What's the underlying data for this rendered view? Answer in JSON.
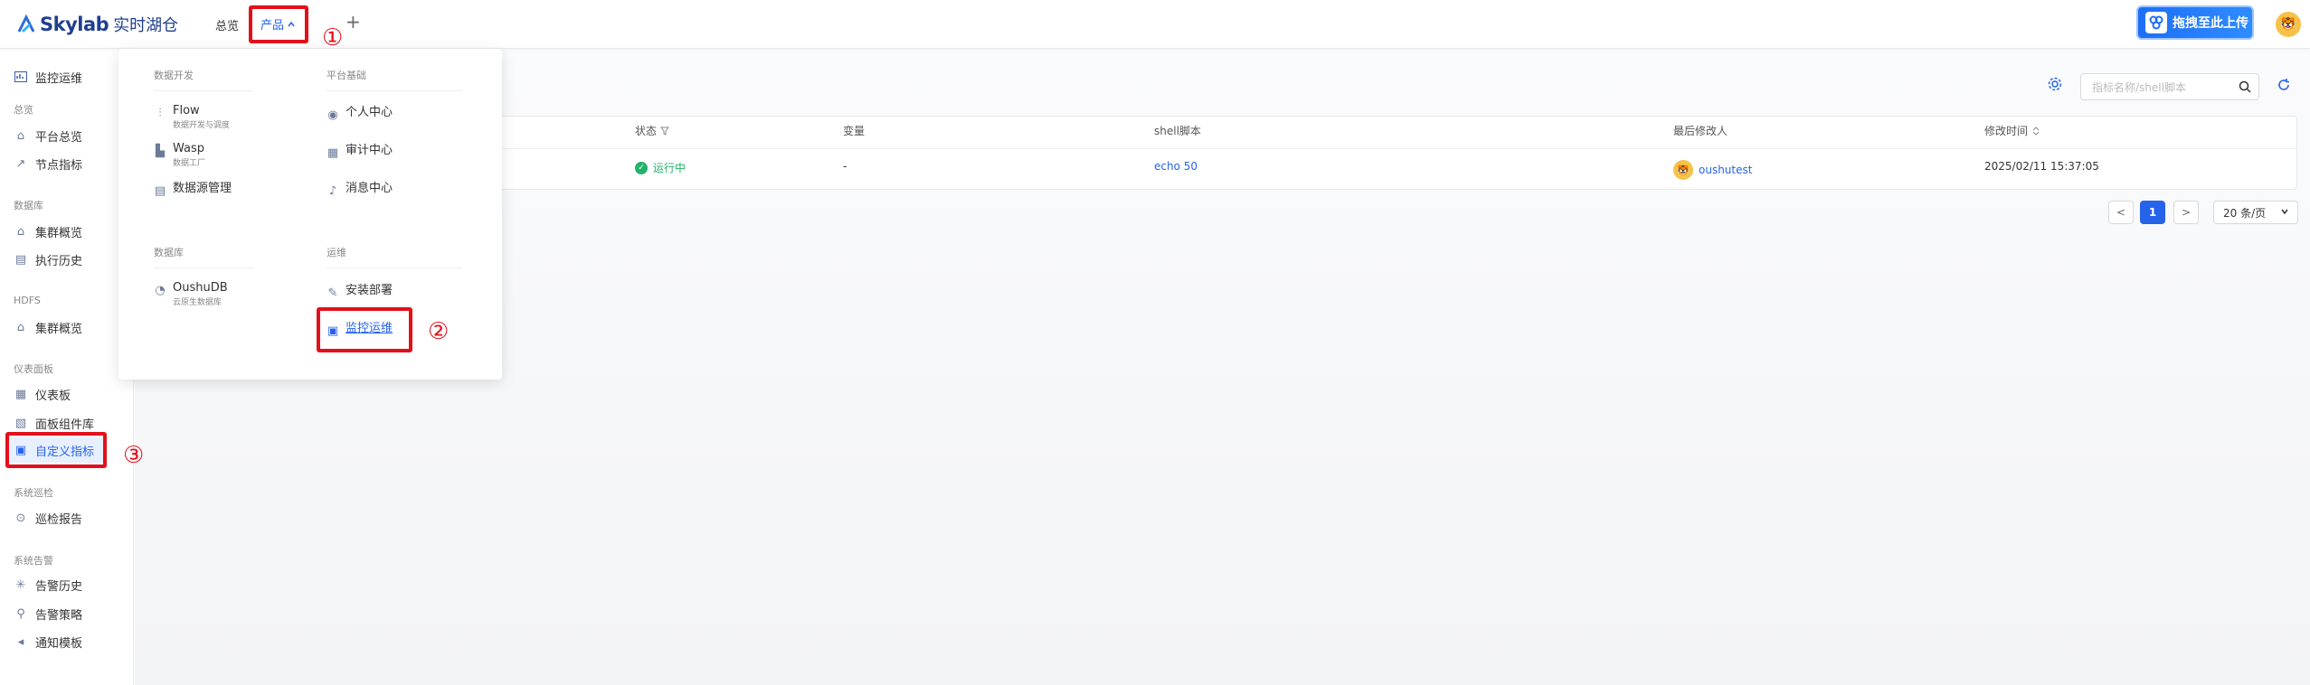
{
  "app": {
    "brand": "Skylab",
    "brand_cn": "实时湖仓"
  },
  "topnav": {
    "overview": "总览",
    "product": "产品",
    "plus": "+"
  },
  "upload": {
    "label": "拖拽至此上传"
  },
  "sidebar": {
    "top_item": "监控运维",
    "groups": [
      {
        "title": "总览",
        "items": [
          "平台总览",
          "节点指标"
        ]
      },
      {
        "title": "数据库",
        "items": [
          "集群概览",
          "执行历史"
        ]
      },
      {
        "title": "HDFS",
        "items": [
          "集群概览"
        ]
      },
      {
        "title": "仪表面板",
        "items": [
          "仪表板",
          "面板组件库",
          "自定义指标"
        ]
      },
      {
        "title": "系统巡检",
        "items": [
          "巡检报告"
        ]
      },
      {
        "title": "系统告警",
        "items": [
          "告警历史",
          "告警策略",
          "通知模板"
        ]
      }
    ]
  },
  "dropdown": {
    "col1_title": "数据开发",
    "col2_title": "平台基础",
    "col3_title": "数据库",
    "col4_title": "运维",
    "flow": {
      "title": "Flow",
      "sub": "数据开发与调度"
    },
    "wasp": {
      "title": "Wasp",
      "sub": "数据工厂"
    },
    "datasource": "数据源管理",
    "personal": "个人中心",
    "audit": "审计中心",
    "message": "消息中心",
    "oushudb": {
      "title": "OushuDB",
      "sub": "云原生数据库"
    },
    "install": "安装部署",
    "monitor": "监控运维"
  },
  "toolbar": {
    "search_placeholder": "指标名称/shell脚本"
  },
  "table": {
    "headers": [
      "状态",
      "变量",
      "shell脚本",
      "最后修改人",
      "修改时间"
    ],
    "rows": [
      {
        "status": "运行中",
        "variable": "-",
        "script": "echo 50",
        "modifier": "oushutest",
        "time": "2025/02/11 15:37:05"
      }
    ]
  },
  "pagination": {
    "current": "1",
    "prev": "<",
    "next": ">",
    "page_size": "20 条/页"
  },
  "annotations": [
    "①",
    "②",
    "③"
  ]
}
